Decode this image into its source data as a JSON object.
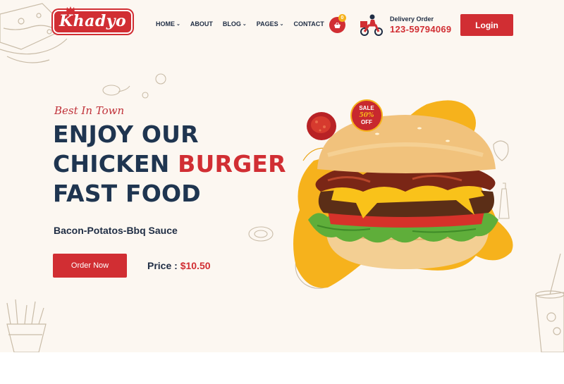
{
  "brand": {
    "name": "Khadyo"
  },
  "nav": {
    "items": [
      {
        "label": "HOME",
        "has_dropdown": true
      },
      {
        "label": "ABOUT",
        "has_dropdown": false
      },
      {
        "label": "BLOG",
        "has_dropdown": true
      },
      {
        "label": "PAGES",
        "has_dropdown": true
      },
      {
        "label": "CONTACT",
        "has_dropdown": false
      }
    ],
    "chevron": "⌄"
  },
  "cart": {
    "count": "0",
    "icon": "basket-icon"
  },
  "delivery": {
    "label": "Delivery Order",
    "phone": "123-59794069",
    "icon": "scooter-icon"
  },
  "header": {
    "login_label": "Login"
  },
  "hero": {
    "tagline": "Best In Town",
    "headline_line1": "ENJOY OUR",
    "headline_line2_plain": "CHICKEN ",
    "headline_line2_accent": "BURGER",
    "headline_line3": "FAST FOOD",
    "subtitle": "Bacon-Potatos-Bbq Sauce",
    "order_button": "Order Now",
    "price_label": "Price : ",
    "price_value": "$10.50",
    "sale_badge_line1": "SALE",
    "sale_badge_line2": "50%",
    "sale_badge_line3": "OFF"
  },
  "colors": {
    "accent": "#d12e33",
    "navy": "#1f3550",
    "background": "#fcf7f1",
    "yellow": "#f6b21c"
  }
}
